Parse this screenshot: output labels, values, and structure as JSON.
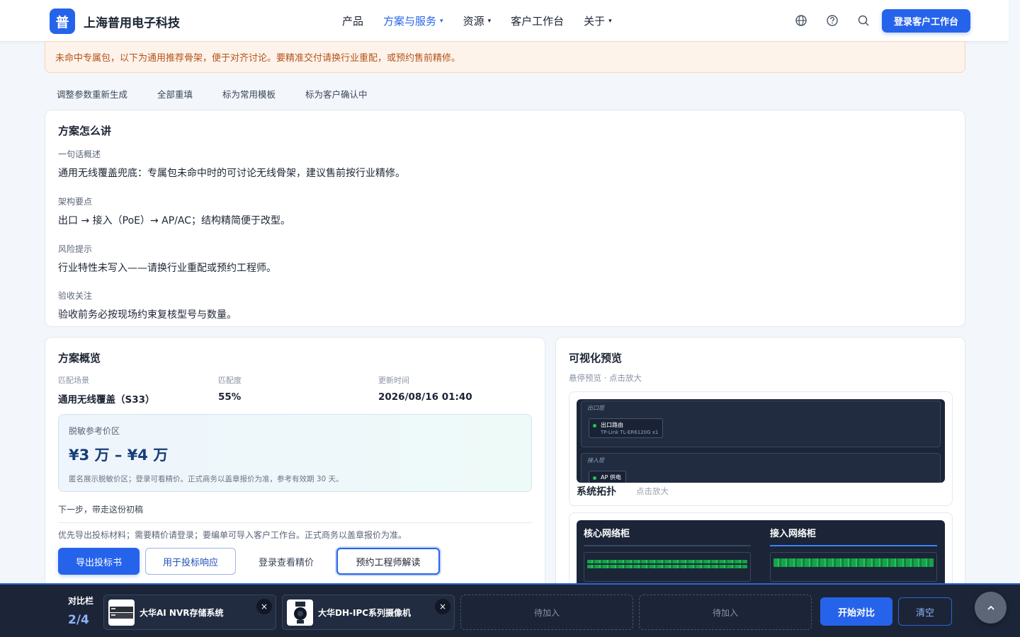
{
  "header": {
    "logo_char": "普",
    "brand": "上海普用电子科技",
    "nav": [
      {
        "label": "产品",
        "dropdown": false,
        "active": false
      },
      {
        "label": "方案与服务",
        "dropdown": true,
        "active": true
      },
      {
        "label": "资源",
        "dropdown": true,
        "active": false
      },
      {
        "label": "客户工作台",
        "dropdown": false,
        "active": false
      },
      {
        "label": "关于",
        "dropdown": true,
        "active": false
      }
    ],
    "login_label": "登录客户工作台",
    "accent": "#2563eb"
  },
  "notice": "未命中专属包，以下为通用推荐骨架，便于对齐讨论。要精准交付请换行业重配，或预约售前精修。",
  "actions": [
    "调整参数重新生成",
    "全部重填",
    "标为常用模板",
    "标为客户确认中"
  ],
  "plan": {
    "title": "方案怎么讲",
    "sections": [
      {
        "label": "一句话概述",
        "text": "通用无线覆盖兜底：专属包未命中时的可讨论无线骨架，建议售前按行业精修。"
      },
      {
        "label": "架构要点",
        "text": "出口 → 接入（PoE）→ AP/AC；结构精简便于改型。"
      },
      {
        "label": "风险提示",
        "text": "行业特性未写入——请换行业重配或预约工程师。"
      },
      {
        "label": "验收关注",
        "text": "验收前务必按现场约束复核型号与数量。"
      }
    ]
  },
  "overview": {
    "title": "方案概览",
    "meta": [
      {
        "label": "匹配场景",
        "value": "通用无线覆盖（S33）"
      },
      {
        "label": "匹配度",
        "value": "55%"
      },
      {
        "label": "更新时间",
        "value": "2026/08/16 01:40"
      }
    ],
    "price_label": "脱敏参考价区",
    "price_value": "¥3 万 – ¥4 万",
    "price_note": "匿名展示脱敏价区；登录可看精价。正式商务以盖章报价为准，参考有效期 30 天。",
    "next_label": "下一步，带走这份初稿",
    "next_text": "优先导出投标材料；需要精价请登录；要编单可导入客户工作台。正式商务以盖章报价为准。",
    "buttons": {
      "export": "导出投标书",
      "bid": "用于投标响应",
      "login_price": "登录查看精价",
      "engineer": "预约工程师解读"
    }
  },
  "preview": {
    "title": "可视化预览",
    "subtitle": "悬停预览 · 点击放大",
    "topo": {
      "caption": "系统拓扑",
      "hint": "点击放大",
      "layer1": "出口层",
      "node1_title": "出口路由",
      "node1_sub": "TP-Link TL-ER6120G x1",
      "layer2": "接入层",
      "node2_title": "AP 供电"
    },
    "rack": {
      "core": "核心网络柜",
      "access": "接入网络柜"
    }
  },
  "compare": {
    "label": "对比栏",
    "count": "2/4",
    "items": [
      {
        "name": "大华AI NVR存储系统"
      },
      {
        "name": "大华DH-IPC系列摄像机"
      }
    ],
    "empty_label": "待加入",
    "start": "开始对比",
    "clear": "清空"
  }
}
